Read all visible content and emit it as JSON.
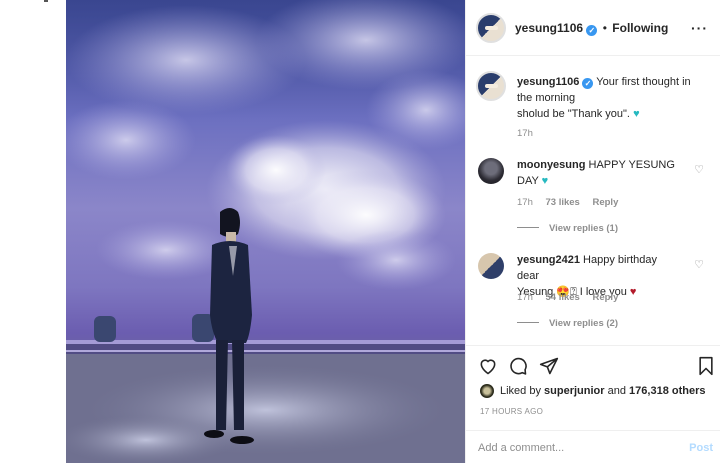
{
  "header": {
    "username": "yesung1106",
    "bullet": "•",
    "follow_status": "Following",
    "more_icon": "more-horizontal-icon"
  },
  "caption": {
    "username": "yesung1106",
    "text_line1": "Your first thought in the morning",
    "text_line2": "sholud be \"Thank you\".",
    "emoji": "♥",
    "time": "17h"
  },
  "comments": [
    {
      "username": "moonyesung",
      "text": "HAPPY YESUNG DAY",
      "emoji": "♥",
      "time": "17h",
      "likes": "73 likes",
      "reply": "Reply",
      "view_replies": "View replies (1)"
    },
    {
      "username": "yesung2421",
      "text_line1": "Happy birthday dear",
      "text_line2_prefix": "Yesung",
      "emoji_face": "😍",
      "emoji_box": "⍰",
      "text_line2_suffix": "I love you",
      "heart": "♥",
      "time": "17h",
      "likes": "54 likes",
      "reply": "Reply",
      "view_replies": "View replies (2)"
    }
  ],
  "actions": {
    "like_icon": "heart-outline-icon",
    "comment_icon": "comment-bubble-icon",
    "share_icon": "paper-plane-icon",
    "save_icon": "bookmark-icon"
  },
  "likes_summary": {
    "prefix": "Liked by",
    "user": "superjunior",
    "conjunction": "and",
    "count": "176,318 others"
  },
  "timestamp": "17 HOURS AGO",
  "comment_box": {
    "placeholder": "Add a comment...",
    "post_label": "Post"
  },
  "colors": {
    "verified_blue": "#3897f0",
    "teal_heart": "#26b9c0",
    "red_heart": "#b31b2b",
    "post_disabled": "#b3dbff",
    "muted_text": "#8e8e8e"
  }
}
